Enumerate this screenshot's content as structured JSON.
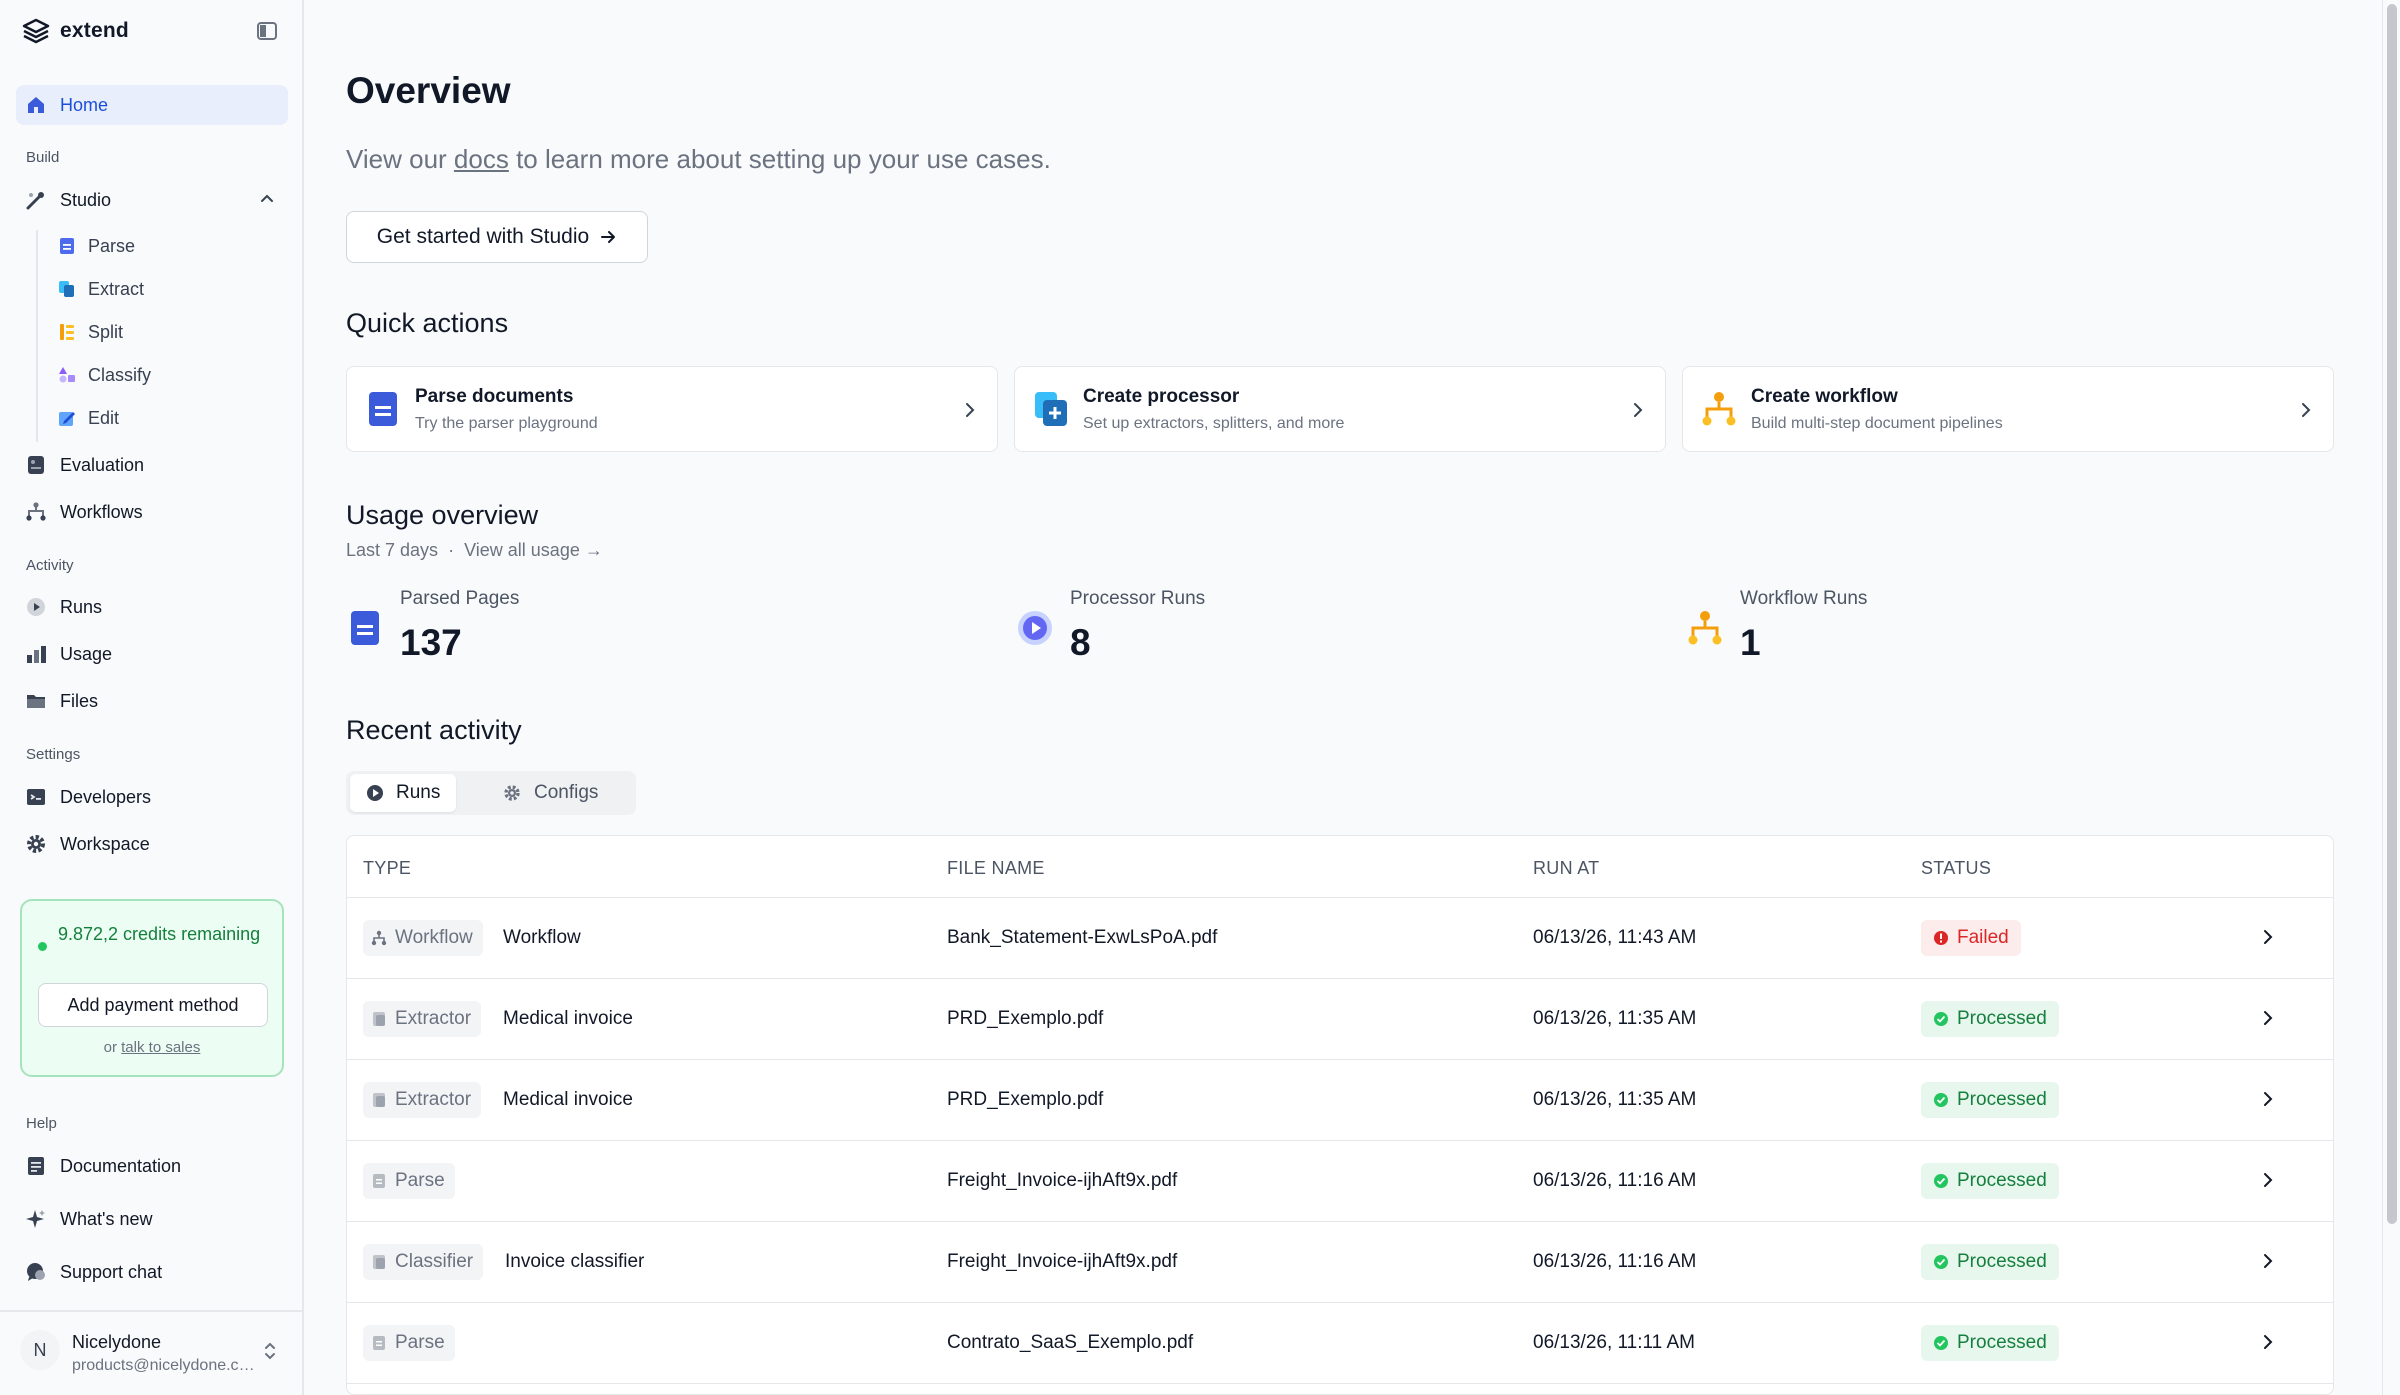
{
  "app": {
    "name": "extend"
  },
  "sidebar": {
    "home": "Home",
    "sections": {
      "build": "Build",
      "activity": "Activity",
      "settings": "Settings",
      "help": "Help"
    },
    "studio": "Studio",
    "studio_items": [
      "Parse",
      "Extract",
      "Split",
      "Classify",
      "Edit"
    ],
    "evaluation": "Evaluation",
    "workflows": "Workflows",
    "runs": "Runs",
    "usage": "Usage",
    "files": "Files",
    "developers": "Developers",
    "workspace": "Workspace",
    "credits": {
      "text": "9.872,2 credits remaining",
      "button": "Add payment method",
      "or": "or",
      "sales_link": "talk to sales"
    },
    "documentation": "Documentation",
    "whats_new": "What's new",
    "support_chat": "Support chat",
    "user": {
      "initial": "N",
      "name": "Nicelydone",
      "email": "products@nicelydone.club"
    }
  },
  "main": {
    "title": "Overview",
    "subtitle_pre": "View our",
    "subtitle_link": "docs",
    "subtitle_post": "to learn more about setting up your use cases.",
    "cta": "Get started with Studio",
    "quick_actions_title": "Quick actions",
    "quick_actions": [
      {
        "title": "Parse documents",
        "desc": "Try the parser playground"
      },
      {
        "title": "Create processor",
        "desc": "Set up extractors, splitters, and more"
      },
      {
        "title": "Create workflow",
        "desc": "Build multi-step document pipelines"
      }
    ],
    "usage_title": "Usage overview",
    "usage_range": "Last 7 days",
    "usage_link": "View all usage",
    "stats": [
      {
        "label": "Parsed Pages",
        "value": "137"
      },
      {
        "label": "Processor Runs",
        "value": "8"
      },
      {
        "label": "Workflow Runs",
        "value": "1"
      }
    ],
    "recent_title": "Recent activity",
    "tabs": [
      "Runs",
      "Configs"
    ],
    "columns": [
      "TYPE",
      "FILE NAME",
      "RUN AT",
      "STATUS"
    ],
    "rows": [
      {
        "type": "Workflow",
        "name": "Workflow",
        "file": "Bank_Statement-ExwLsPoA.pdf",
        "run_at": "06/13/26, 11:43 AM",
        "status": "Failed"
      },
      {
        "type": "Extractor",
        "name": "Medical invoice",
        "file": "PRD_Exemplo.pdf",
        "run_at": "06/13/26, 11:35 AM",
        "status": "Processed"
      },
      {
        "type": "Extractor",
        "name": "Medical invoice",
        "file": "PRD_Exemplo.pdf",
        "run_at": "06/13/26, 11:35 AM",
        "status": "Processed"
      },
      {
        "type": "Parse",
        "name": "",
        "file": "Freight_Invoice-ijhAft9x.pdf",
        "run_at": "06/13/26, 11:16 AM",
        "status": "Processed"
      },
      {
        "type": "Classifier",
        "name": "Invoice classifier",
        "file": "Freight_Invoice-ijhAft9x.pdf",
        "run_at": "06/13/26, 11:16 AM",
        "status": "Processed"
      },
      {
        "type": "Parse",
        "name": "",
        "file": "Contrato_SaaS_Exemplo.pdf",
        "run_at": "06/13/26, 11:11 AM",
        "status": "Processed"
      }
    ]
  },
  "colors": {
    "accent": "#2563eb",
    "active_bg": "#e8eefc",
    "success": "#15803d",
    "danger": "#dc2626",
    "orange": "#f59e0b"
  }
}
